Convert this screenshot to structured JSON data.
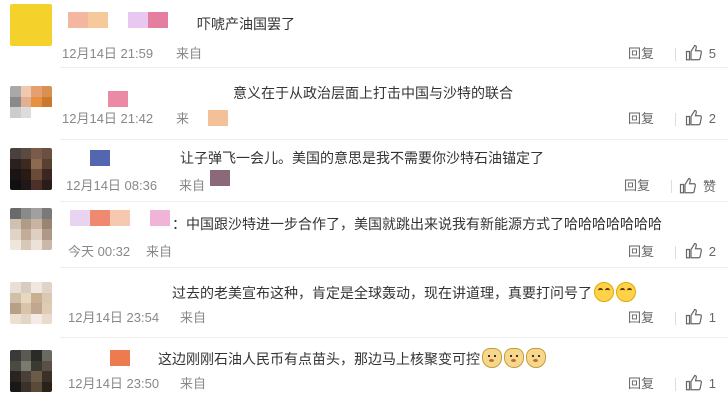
{
  "comments": [
    {
      "text": "吓唬产油国罢了",
      "date": "12月14日 21:59",
      "source": "来自",
      "reply_label": "回复",
      "like_count": "5",
      "emojis": []
    },
    {
      "text": "意义在于从政治层面上打击中国与沙特的联合",
      "date": "12月14日 21:42",
      "source": "来",
      "reply_label": "回复",
      "like_count": "2",
      "emojis": []
    },
    {
      "text": "让子弹飞一会儿。美国的意思是我不需要你沙特石油锚定了",
      "date": "12月14日 08:36",
      "source": "来自",
      "reply_label": "回复",
      "like_count": "赞",
      "emojis": []
    },
    {
      "text": "：中国跟沙特进一步合作了，美国就跳出来说我有新能源方式了哈哈哈哈哈哈哈",
      "date": "今天 00:32",
      "source": "来自",
      "reply_label": "回复",
      "like_count": "2",
      "emojis": []
    },
    {
      "text": "过去的老美宣布这种，肯定是全球轰动，现在讲道理，真要打问号了",
      "date": "12月14日 23:54",
      "source": "来自",
      "reply_label": "回复",
      "like_count": "1",
      "emojis": [
        "laugh-cry-emoji",
        "laugh-cry-emoji"
      ]
    },
    {
      "text": "这边刚刚石油人民币有点苗头，那边马上核聚变可控",
      "date": "12月14日 23:50",
      "source": "来自",
      "reply_label": "回复",
      "like_count": "1",
      "emojis": [
        "doge-emoji",
        "doge-emoji",
        "doge-emoji"
      ]
    }
  ],
  "colors": {
    "text": "#333333",
    "meta": "#888888",
    "divider": "#eeeeee"
  }
}
